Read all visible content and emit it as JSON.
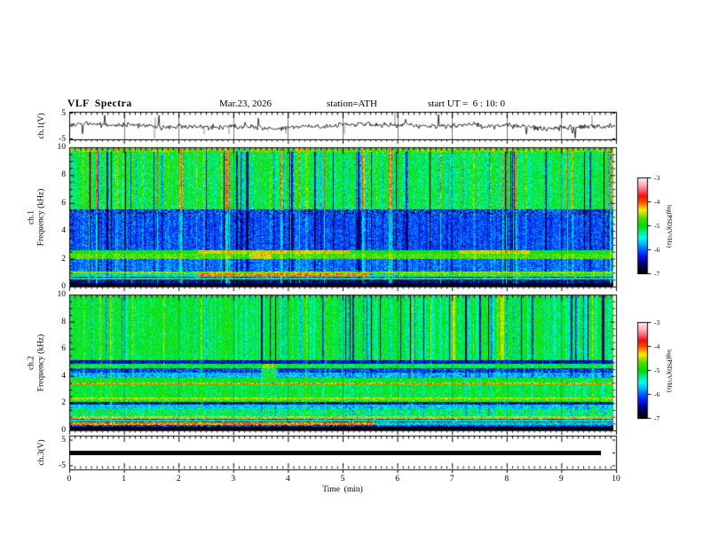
{
  "header": {
    "title": "VLF Spectra",
    "date": "Mar.23, 2026",
    "station": "station=ATH",
    "start_ut": "start UT =  6 : 10: 0"
  },
  "x_axis": {
    "label": "Time  (min)",
    "ticks": [
      "0",
      "1",
      "2",
      "3",
      "4",
      "5",
      "6",
      "7",
      "8",
      "9",
      "10"
    ],
    "range_min": [
      0,
      10
    ]
  },
  "panels": {
    "ch1_wave": {
      "ylabel": "ch.1(V)",
      "yticks": [
        "5",
        "-5"
      ],
      "yrange_v": [
        -5,
        5
      ]
    },
    "ch1_spec": {
      "ylabel_line1": "ch.1",
      "ylabel_line2": "Frequency  (kHz)",
      "yticks": [
        "10",
        "8",
        "6",
        "4",
        "2",
        "0"
      ],
      "yrange_khz": [
        0,
        10
      ]
    },
    "ch2_spec": {
      "ylabel_line1": "ch.2",
      "ylabel_line2": "Frequency  (kHz)",
      "yticks": [
        "10",
        "8",
        "6",
        "4",
        "2",
        "0"
      ],
      "yrange_khz": [
        0,
        10
      ]
    },
    "ch3_wave": {
      "ylabel": "ch.3(V)",
      "yticks": [
        "5",
        "-5"
      ],
      "yrange_v": [
        -5,
        5
      ]
    }
  },
  "colorbar": {
    "ticks": [
      "-3",
      "-4",
      "-5",
      "-6",
      "-7"
    ],
    "label": "log(PSD)(V²/Hz)",
    "value_range": [
      -7,
      -3
    ],
    "colormap_stops": [
      [
        0.0,
        "#000000"
      ],
      [
        0.06,
        "#000030"
      ],
      [
        0.13,
        "#0000a0"
      ],
      [
        0.2,
        "#0022ff"
      ],
      [
        0.27,
        "#0077ff"
      ],
      [
        0.33,
        "#00ccff"
      ],
      [
        0.38,
        "#00ffee"
      ],
      [
        0.44,
        "#00f080"
      ],
      [
        0.5,
        "#00dd00"
      ],
      [
        0.58,
        "#44dd00"
      ],
      [
        0.63,
        "#a8e400"
      ],
      [
        0.67,
        "#ffee00"
      ],
      [
        0.71,
        "#ffa500"
      ],
      [
        0.76,
        "#ff4400"
      ],
      [
        0.82,
        "#ee1111"
      ],
      [
        0.87,
        "#ff5566"
      ],
      [
        0.93,
        "#ffaab4"
      ],
      [
        1.0,
        "#fdecee"
      ]
    ]
  },
  "chart_data": {
    "ch1_wave": {
      "type": "line",
      "panel": "ch.1(V)",
      "description": "broadband noisy voltage waveform, mean 0 V, typical amplitude ±1 V, sporadic impulsive spikes to ±5 V across 0-10 min",
      "x_range_min": [
        0,
        10
      ],
      "y_range_v": [
        -5,
        5
      ],
      "seed": 5,
      "rms_v": 0.8,
      "spike_prob": 0.02
    },
    "ch1_spec": {
      "type": "heatmap",
      "panel": "ch.1 spectrogram",
      "x_range_min": [
        0,
        10
      ],
      "freq_range_khz": [
        0,
        10
      ],
      "log_psd_range": [
        -7,
        -3
      ],
      "seed": 11,
      "streaks": {
        "bright_prob": 0.055,
        "dark_prob": 0.07,
        "dark_ramp": false,
        "yellow_streaks_min": []
      },
      "bands": [
        {
          "f0": 9.75,
          "f1": 10.01,
          "base": -4.6,
          "noise": 0.45,
          "bright": 0.5,
          "dark": 0.8
        },
        {
          "f0": 5.55,
          "f1": 9.75,
          "base": -5.05,
          "noise": 0.38,
          "bright": 1.05,
          "dark": 1.5
        },
        {
          "f0": 5.28,
          "f1": 5.55,
          "base": -6.2,
          "noise": 0.7,
          "bright": 0.4,
          "dark": 0.4
        },
        {
          "f0": 2.62,
          "f1": 5.28,
          "base": -6.05,
          "noise": 0.33,
          "bright": 0.55,
          "dark": 0.75
        },
        {
          "f0": 2.35,
          "f1": 2.62,
          "base": -4.95,
          "noise": 0.3,
          "bright": 0.25,
          "dark": 0.35,
          "patches": [
            {
              "x0": 2.35,
              "x1": 5.15,
              "dv": 0.6
            },
            {
              "x0": 7.15,
              "x1": 8.45,
              "dv": 0.55
            }
          ]
        },
        {
          "f0": 2.0,
          "f1": 2.35,
          "base": -4.7,
          "noise": 0.28,
          "bright": 0.25,
          "dark": 0.35,
          "patches": [
            {
              "x0": 3.3,
              "x1": 3.7,
              "dv": 0.35
            }
          ]
        },
        {
          "f0": 1.08,
          "f1": 2.0,
          "base": -5.95,
          "noise": 0.35,
          "bright": 0.5,
          "dark": 0.6
        },
        {
          "f0": 0.93,
          "f1": 1.08,
          "base": -4.55,
          "noise": 0.3,
          "bright": 0.2,
          "dark": 0.2
        },
        {
          "f0": 0.76,
          "f1": 0.93,
          "base": -5.35,
          "noise": 0.5,
          "bright": 0.3,
          "dark": 0.5,
          "patches": [
            {
              "x0": 2.35,
              "x1": 5.5,
              "dv": 1.3
            },
            {
              "x0": 6.0,
              "x1": 9.9,
              "dv": 0.55
            }
          ]
        },
        {
          "f0": 0.5,
          "f1": 0.76,
          "base": -5.1,
          "noise": 0.55,
          "bright": 0.3,
          "dark": 0.4,
          "rowstripe": 1.1
        },
        {
          "f0": 0.28,
          "f1": 0.5,
          "base": -6.55,
          "noise": 0.5,
          "bright": 0.8,
          "dark": 0.3
        },
        {
          "f0": 0.13,
          "f1": 0.28,
          "base": -6.85,
          "noise": 0.3,
          "bright": 0.5,
          "dark": 0.2
        },
        {
          "f0": 0.0,
          "f1": 0.13,
          "base": -7.0,
          "noise": 0.08
        }
      ]
    },
    "ch2_spec": {
      "type": "heatmap",
      "panel": "ch.2 spectrogram",
      "x_range_min": [
        0,
        10
      ],
      "freq_range_khz": [
        0,
        10
      ],
      "log_psd_range": [
        -7,
        -3
      ],
      "seed": 77,
      "streaks": {
        "bright_prob": 0.04,
        "dark_prob": 0.085,
        "dark_ramp": true,
        "yellow_streaks_min": [
          7.05,
          7.95
        ]
      },
      "bands": [
        {
          "f0": 5.2,
          "f1": 10.01,
          "base": -5.0,
          "noise": 0.3,
          "bright": 0.45,
          "dark": 1.35,
          "streakband": true
        },
        {
          "f0": 4.95,
          "f1": 5.2,
          "base": -6.35,
          "noise": 0.45,
          "bright": 0.3,
          "dark": 0.3
        },
        {
          "f0": 4.58,
          "f1": 4.95,
          "base": -5.1,
          "noise": 0.3,
          "bright": 0.3,
          "dark": 0.4,
          "patches": [
            {
              "x0": 3.5,
              "x1": 3.8,
              "dv": 0.55
            }
          ]
        },
        {
          "f0": 4.3,
          "f1": 4.58,
          "base": -6.15,
          "noise": 0.5,
          "bright": 0.35,
          "dark": 0.3,
          "patches": [
            {
              "x0": 3.5,
              "x1": 3.8,
              "dv": 0.9
            }
          ]
        },
        {
          "f0": 3.85,
          "f1": 4.3,
          "base": -5.7,
          "noise": 0.42,
          "bright": 0.4,
          "dark": 0.45,
          "patches": [
            {
              "x0": 3.5,
              "x1": 3.8,
              "dv": 0.8
            }
          ]
        },
        {
          "f0": 3.58,
          "f1": 3.85,
          "base": -5.0,
          "noise": 0.3,
          "bright": 0.25,
          "dark": 0.3
        },
        {
          "f0": 3.4,
          "f1": 3.58,
          "base": -4.2,
          "noise": 0.4
        },
        {
          "f0": 2.45,
          "f1": 3.4,
          "base": -5.05,
          "noise": 0.3,
          "bright": 0.3,
          "dark": 0.4
        },
        {
          "f0": 2.28,
          "f1": 2.45,
          "base": -4.5,
          "noise": 0.3
        },
        {
          "f0": 2.1,
          "f1": 2.28,
          "base": -4.85,
          "noise": 0.45
        },
        {
          "f0": 1.92,
          "f1": 2.1,
          "base": -6.45,
          "noise": 0.55,
          "bright": 0.4
        },
        {
          "f0": 1.55,
          "f1": 1.92,
          "base": -5.6,
          "noise": 0.45,
          "bright": 0.3,
          "dark": 0.3
        },
        {
          "f0": 1.05,
          "f1": 1.55,
          "base": -5.15,
          "noise": 0.4,
          "bright": 0.25,
          "dark": 0.5
        },
        {
          "f0": 0.85,
          "f1": 1.05,
          "base": -4.35,
          "noise": 0.35
        },
        {
          "f0": 0.6,
          "f1": 0.85,
          "base": -5.2,
          "noise": 0.45,
          "rowstripe": 0.85
        },
        {
          "f0": 0.38,
          "f1": 0.6,
          "base": -5.5,
          "noise": 0.45,
          "patches": [
            {
              "x0": 0,
              "x1": 5.6,
              "dv": 1.4
            },
            {
              "x0": 5.6,
              "x1": 10,
              "dv": -0.15
            }
          ]
        },
        {
          "f0": 0.18,
          "f1": 0.38,
          "base": -6.3,
          "noise": 0.6,
          "rowstripe": 1.0
        },
        {
          "f0": 0.0,
          "f1": 0.18,
          "base": -6.9,
          "noise": 0.18
        }
      ]
    },
    "ch3_wave": {
      "type": "line",
      "panel": "ch.3(V)",
      "description": "flat constant trace (no signal) drawn as a thick black bar",
      "x_range_min": [
        0,
        9.7
      ],
      "constant_value_v": 0.3
    }
  }
}
